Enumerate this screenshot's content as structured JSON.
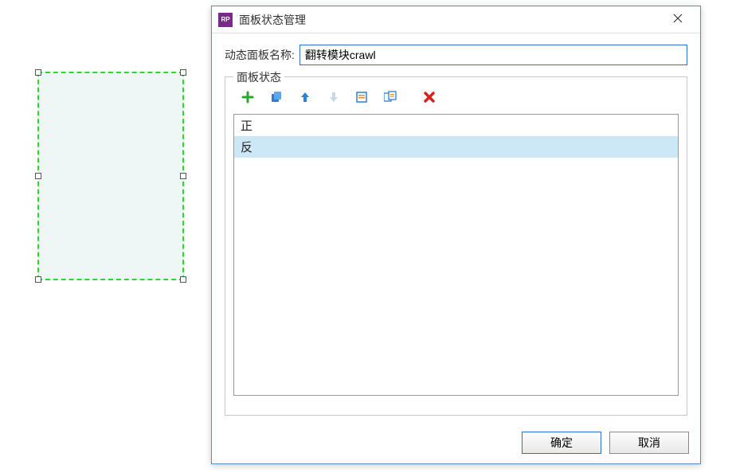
{
  "dialog": {
    "title": "面板状态管理",
    "app_icon_text": "RP",
    "name_label": "动态面板名称:",
    "name_value": "翻转模块crawl",
    "fieldset_label": "面板状态",
    "ok_label": "确定",
    "cancel_label": "取消"
  },
  "toolbar": {
    "add": "add-icon",
    "duplicate": "duplicate-icon",
    "move_up": "arrow-up-icon",
    "move_down": "arrow-down-icon",
    "edit": "edit-states-icon",
    "edit_all": "edit-all-icon",
    "delete": "delete-icon"
  },
  "states": [
    {
      "label": "正",
      "selected": false
    },
    {
      "label": "反",
      "selected": true
    }
  ]
}
